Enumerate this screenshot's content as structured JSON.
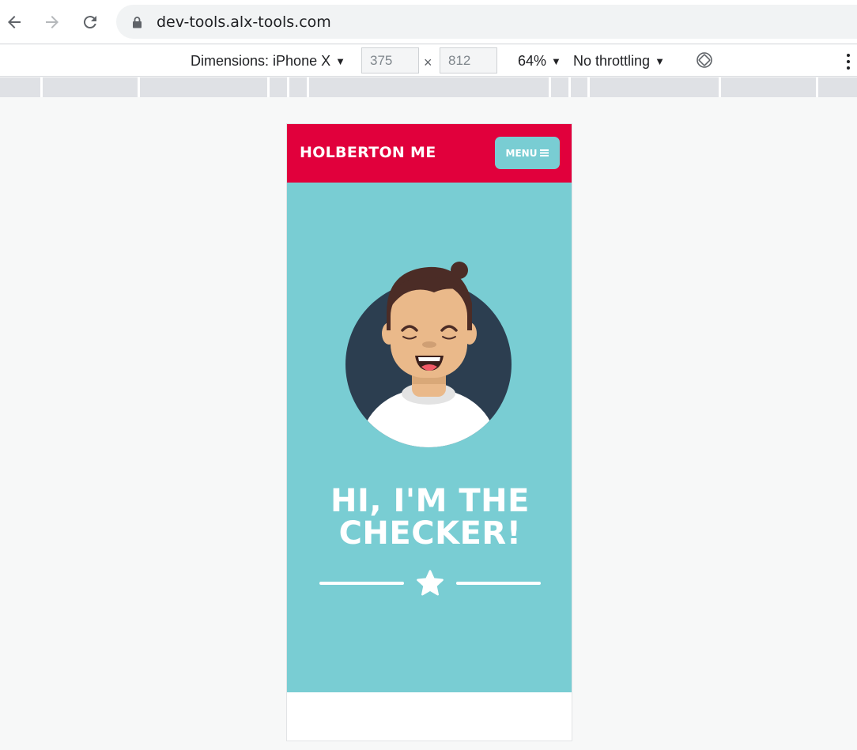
{
  "browser": {
    "url": "dev-tools.alx-tools.com",
    "back_icon": "arrow-left-icon",
    "forward_icon": "arrow-right-icon",
    "reload_icon": "reload-icon",
    "lock_icon": "lock-icon"
  },
  "device_toolbar": {
    "dimensions_label": "Dimensions: iPhone X",
    "width_value": "375",
    "height_value": "812",
    "times_symbol": "×",
    "zoom_label": "64%",
    "throttling_label": "No throttling",
    "rotate_icon": "rotate-icon",
    "more_icon": "kebab-menu-icon"
  },
  "site": {
    "brand": "HOLBERTON ME",
    "menu_label": "MENU",
    "menu_icon": "hamburger-icon",
    "hero_title_line1": "HI, I'M THE",
    "hero_title_line2": "CHECKER!",
    "colors": {
      "header": "#e1003c",
      "hero": "#79cdd3",
      "avatar_bg": "#2c3e50",
      "text": "#ffffff"
    }
  }
}
